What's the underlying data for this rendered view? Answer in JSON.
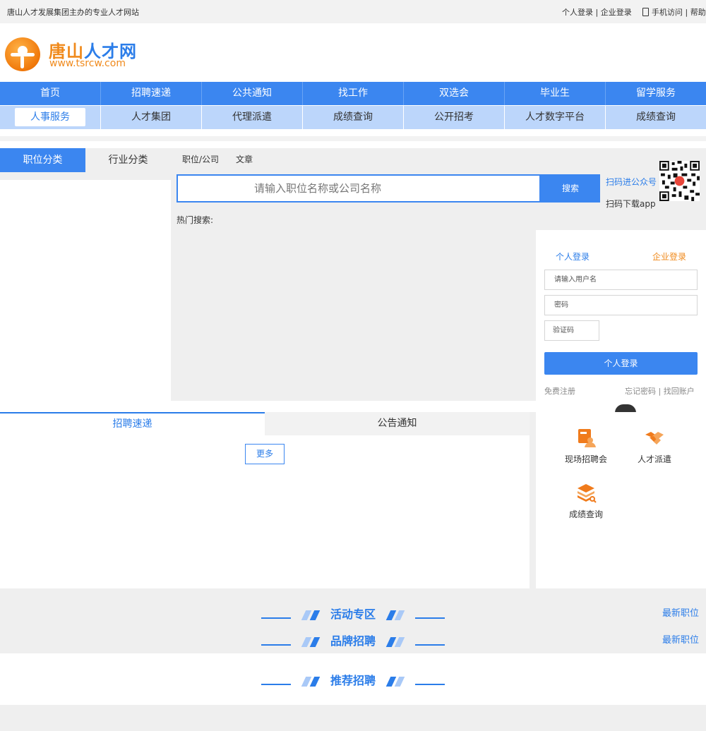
{
  "topbar": {
    "slogan": "唐山人才发展集团主办的专业人才网站",
    "personal_login": "个人登录",
    "separator": " | ",
    "company_login": "企业登录",
    "mobile": "手机访问",
    "help": "帮助"
  },
  "logo": {
    "name_part1": "唐山",
    "name_part2": "人才网",
    "url": "www.tsrcw.com"
  },
  "nav_primary": [
    "首页",
    "招聘速递",
    "公共通知",
    "找工作",
    "双选会",
    "毕业生",
    "留学服务"
  ],
  "nav_secondary": {
    "active": "人事服务",
    "items": [
      "人才集团",
      "代理派遣",
      "成绩查询",
      "公开招考",
      "人才数字平台",
      "成绩查询"
    ]
  },
  "categories": {
    "tab_active": "职位分类",
    "tab_inactive": "行业分类"
  },
  "search": {
    "tab_jobs": "职位/公司",
    "tab_articles": "文章",
    "placeholder": "请输入职位名称或公司名称",
    "button": "搜索",
    "hot_label": "热门搜索:"
  },
  "qr": {
    "wechat_label": "扫码进公众号",
    "app_label": "扫码下载app"
  },
  "login": {
    "tab_personal": "个人登录",
    "tab_company": "企业登录",
    "username_placeholder": "请输入用户名",
    "password_placeholder": "密码",
    "captcha_placeholder": "验证码",
    "submit": "个人登录",
    "register": "免费注册",
    "forgot_password": "忘记密码",
    "find_account": "找回账户"
  },
  "news": {
    "tab_active": "招聘速递",
    "tab_inactive": "公告通知",
    "more": "更多"
  },
  "services": [
    {
      "label": "现场招聘会",
      "icon": "job-fair-icon"
    },
    {
      "label": "人才派遣",
      "icon": "handshake-icon"
    },
    {
      "label": "成绩查询",
      "icon": "stack-search-icon"
    }
  ],
  "zones": {
    "activity": "活动专区",
    "brand": "品牌招聘",
    "recommend": "推荐招聘",
    "latest_jobs": "最新职位"
  },
  "colors": {
    "primary": "#3b86f0",
    "accent": "#f08a1c",
    "nav_secondary_bg": "#bcd6fb"
  }
}
